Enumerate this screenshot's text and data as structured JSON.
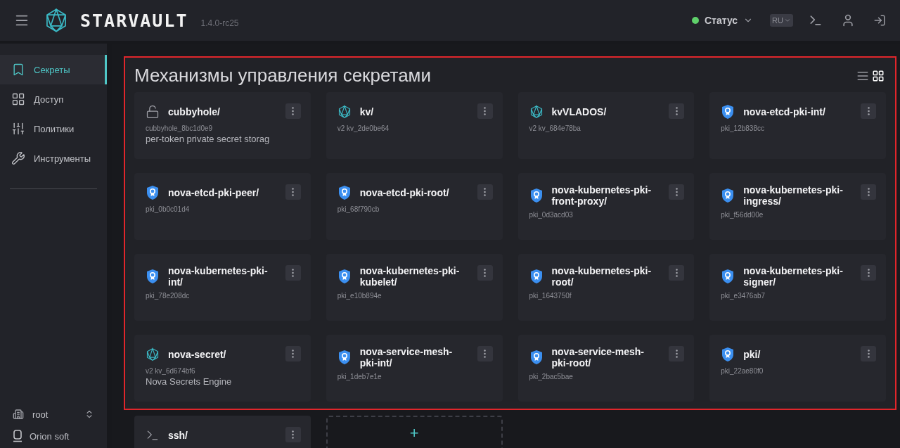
{
  "header": {
    "brand": "STARVAULT",
    "version": "1.4.0-rc25",
    "status": "Статус",
    "language": "RU"
  },
  "sidebar": {
    "items": [
      {
        "label": "Секреты",
        "selected": true
      },
      {
        "label": "Доступ",
        "selected": false
      },
      {
        "label": "Политики",
        "selected": false
      },
      {
        "label": "Инструменты",
        "selected": false
      }
    ],
    "namespace": "root",
    "organization": "Orion soft"
  },
  "highlighted_section": {
    "title": "Механизмы управления секретами",
    "view_modes": [
      {
        "kind": "list",
        "selected": false
      },
      {
        "kind": "grid",
        "selected": true
      }
    ],
    "engines": [
      {
        "kind": "cubbyhole",
        "name": "cubbyhole/",
        "path": "cubbyhole_8bc1d0e9",
        "description": "per-token private secret storag"
      },
      {
        "kind": "kv",
        "name": "kv/",
        "path": "v2 kv_2de0be64"
      },
      {
        "kind": "kv",
        "name": "kvVLADOS/",
        "path": "v2 kv_684e78ba"
      },
      {
        "kind": "pki",
        "name": "nova-etcd-pki-int/",
        "path": "pki_12b838cc"
      },
      {
        "kind": "pki",
        "name": "nova-etcd-pki-peer/",
        "path": "pki_0b0c01d4"
      },
      {
        "kind": "pki",
        "name": "nova-etcd-pki-root/",
        "path": "pki_68f790cb"
      },
      {
        "kind": "pki",
        "name": "nova-kubernetes-pki-front-proxy/",
        "path": "pki_0d3acd03"
      },
      {
        "kind": "pki",
        "name": "nova-kubernetes-pki-ingress/",
        "path": "pki_f56dd00e"
      },
      {
        "kind": "pki",
        "name": "nova-kubernetes-pki-int/",
        "path": "pki_78e208dc"
      },
      {
        "kind": "pki",
        "name": "nova-kubernetes-pki-kubelet/",
        "path": "pki_e10b894e"
      },
      {
        "kind": "pki",
        "name": "nova-kubernetes-pki-root/",
        "path": "pki_1643750f"
      },
      {
        "kind": "pki",
        "name": "nova-kubernetes-pki-signer/",
        "path": "pki_e3476ab7"
      },
      {
        "kind": "kv",
        "name": "nova-secret/",
        "path": "v2 kv_6d674bf6",
        "description": "Nova Secrets Engine"
      },
      {
        "kind": "pki",
        "name": "nova-service-mesh-pki-int/",
        "path": "pki_1deb7e1e"
      },
      {
        "kind": "pki",
        "name": "nova-service-mesh-pki-root/",
        "path": "pki_2bac5bae"
      },
      {
        "kind": "pki",
        "name": "pki/",
        "path": "pki_22ae80f0"
      }
    ]
  },
  "more_engines": [
    {
      "kind": "ssh",
      "name": "ssh/"
    }
  ],
  "add_card": {
    "label": "+"
  }
}
